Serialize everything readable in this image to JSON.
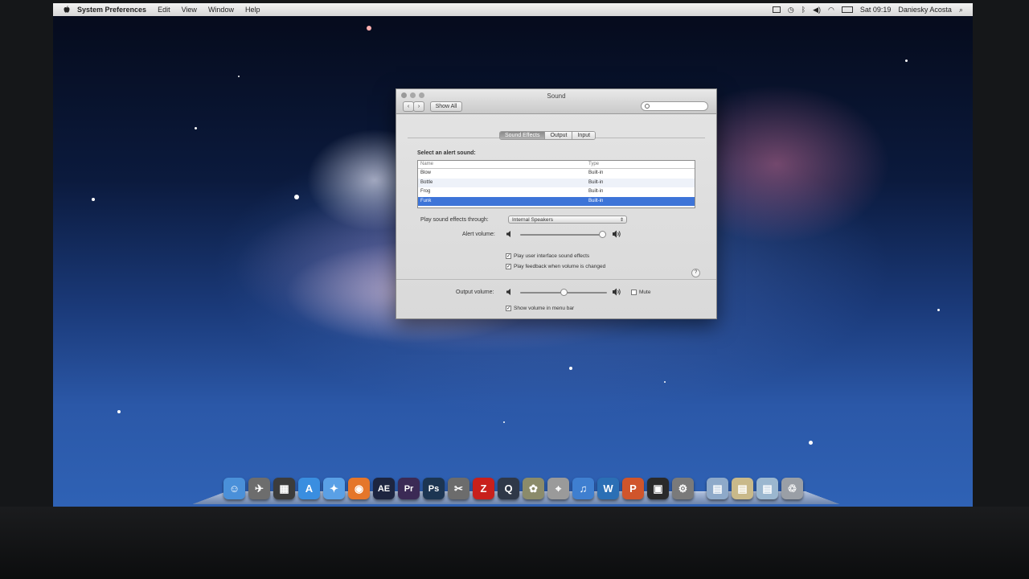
{
  "menubar": {
    "app_name": "System Preferences",
    "menus": [
      "Edit",
      "View",
      "Window",
      "Help"
    ],
    "clock": "Sat 09:19",
    "user": "Daniesky Acosta"
  },
  "window": {
    "title": "Sound",
    "show_all_label": "Show All",
    "tabs": [
      {
        "label": "Sound Effects",
        "active": true
      },
      {
        "label": "Output",
        "active": false
      },
      {
        "label": "Input",
        "active": false
      }
    ],
    "select_label": "Select an alert sound:",
    "list_headers": {
      "name": "Name",
      "type": "Type"
    },
    "sounds": [
      {
        "name": "Blow",
        "type": "Built-in"
      },
      {
        "name": "Bottle",
        "type": "Built-in"
      },
      {
        "name": "Frog",
        "type": "Built-in"
      },
      {
        "name": "Funk",
        "type": "Built-in",
        "selected": true
      }
    ],
    "play_through_label": "Play sound effects through:",
    "play_through_value": "Internal Speakers",
    "alert_volume_label": "Alert volume:",
    "alert_volume_level": 0.98,
    "checkboxes": [
      {
        "label": "Play user interface sound effects",
        "checked": true
      },
      {
        "label": "Play feedback when volume is changed",
        "checked": true
      }
    ],
    "output_volume_label": "Output volume:",
    "output_volume_level": 0.5,
    "mute_label": "Mute",
    "mute_checked": false,
    "show_volume_label": "Show volume in menu bar",
    "show_volume_checked": true
  },
  "dock": {
    "apps": [
      {
        "name": "finder-icon",
        "glyph": "☺",
        "color": "#4a90d9"
      },
      {
        "name": "launchpad-icon",
        "glyph": "✈",
        "color": "#6d6d6d"
      },
      {
        "name": "mission-control-icon",
        "glyph": "▦",
        "color": "#3c3c3c"
      },
      {
        "name": "app-store-icon",
        "glyph": "A",
        "color": "#3a8ee0"
      },
      {
        "name": "safari-icon",
        "glyph": "✦",
        "color": "#5aa0e6"
      },
      {
        "name": "firefox-icon",
        "glyph": "◉",
        "color": "#e5762a"
      },
      {
        "name": "after-effects-icon",
        "glyph": "AE",
        "color": "#1d2540"
      },
      {
        "name": "premiere-icon",
        "glyph": "Pr",
        "color": "#3b2a55"
      },
      {
        "name": "photoshop-icon",
        "glyph": "Ps",
        "color": "#1c3552"
      },
      {
        "name": "final-cut-icon",
        "glyph": "✂",
        "color": "#6c6c6c"
      },
      {
        "name": "filezilla-icon",
        "glyph": "Z",
        "color": "#c8201c"
      },
      {
        "name": "quicktime-icon",
        "glyph": "Q",
        "color": "#2f3848"
      },
      {
        "name": "iphoto-icon",
        "glyph": "✿",
        "color": "#8b8b6a"
      },
      {
        "name": "image-capture-icon",
        "glyph": "⌖",
        "color": "#9a9a9a"
      },
      {
        "name": "itunes-icon",
        "glyph": "♫",
        "color": "#3f7fd0"
      },
      {
        "name": "word-icon",
        "glyph": "W",
        "color": "#2b6fb5"
      },
      {
        "name": "powerpoint-icon",
        "glyph": "P",
        "color": "#d0552b"
      },
      {
        "name": "photo-booth-icon",
        "glyph": "▣",
        "color": "#2a2a2a"
      },
      {
        "name": "system-preferences-icon",
        "glyph": "⚙",
        "color": "#7a7a7a"
      },
      {
        "name": "applications-folder-icon",
        "glyph": "▤",
        "color": "#8ea9c9"
      },
      {
        "name": "documents-folder-icon",
        "glyph": "▤",
        "color": "#c9b98a"
      },
      {
        "name": "downloads-folder-icon",
        "glyph": "▤",
        "color": "#9bb7cf"
      },
      {
        "name": "trash-icon",
        "glyph": "♲",
        "color": "#9a9fa6"
      }
    ]
  }
}
